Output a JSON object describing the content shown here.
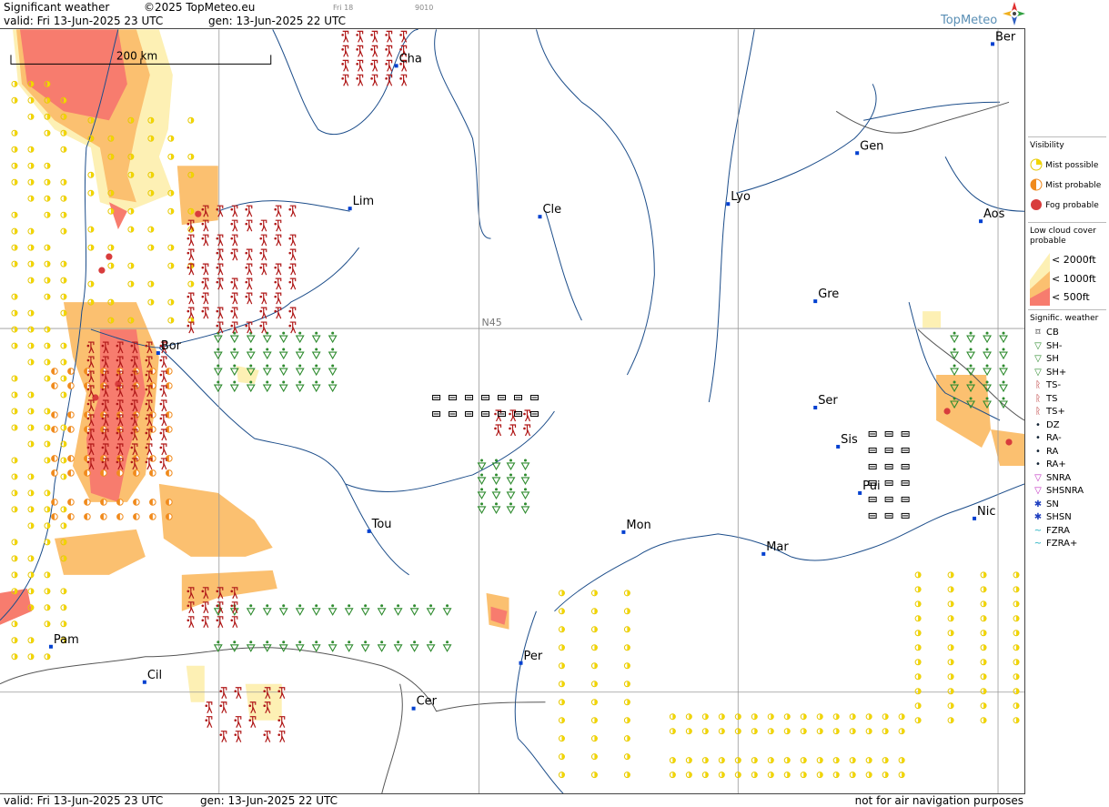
{
  "header": {
    "title": "Significant weather",
    "copyright": "©2025 TopMeteo.eu",
    "small_date": "Fri 18",
    "small_code": "9010",
    "valid": "valid:  Fri  13-Jun-2025  23 UTC",
    "gen": "gen: 13-Jun-2025 22 UTC",
    "logo": "TopMeteo"
  },
  "footer": {
    "valid": "valid:  Fri  13-Jun-2025  23 UTC",
    "gen": "gen: 13-Jun-2025 22 UTC",
    "disclaimer": "not for air navigation purposes"
  },
  "map": {
    "scale_label": "200 km",
    "lat_label": "N45",
    "cities": [
      {
        "name": "Cha"
      },
      {
        "name": "Lim"
      },
      {
        "name": "Cle"
      },
      {
        "name": "Lyo"
      },
      {
        "name": "Gen"
      },
      {
        "name": "Ber"
      },
      {
        "name": "Aos"
      },
      {
        "name": "Gre"
      },
      {
        "name": "Bor"
      },
      {
        "name": "Ser"
      },
      {
        "name": "Sis"
      },
      {
        "name": "Pui"
      },
      {
        "name": "Nic"
      },
      {
        "name": "Tou"
      },
      {
        "name": "Mon"
      },
      {
        "name": "Mar"
      },
      {
        "name": "Pam"
      },
      {
        "name": "Cil"
      },
      {
        "name": "Per"
      },
      {
        "name": "Cer"
      }
    ]
  },
  "legend": {
    "visibility_title": "Visibility",
    "visibility": [
      {
        "label": "Mist possible",
        "color": "#f2d600"
      },
      {
        "label": "Mist probable",
        "color": "#f08a1c"
      },
      {
        "label": "Fog probable",
        "color": "#e04848"
      }
    ],
    "cloud_title_1": "Low cloud cover",
    "cloud_title_2": "probable",
    "cloud": [
      {
        "label": "< 2000ft",
        "color": "#fdf0b4"
      },
      {
        "label": "< 1000ft",
        "color": "#fbc070"
      },
      {
        "label": "<   500ft",
        "color": "#f77c6e"
      }
    ],
    "wx_title": "Signific. weather",
    "wx": [
      {
        "label": "CB",
        "icon": "cb-icon"
      },
      {
        "label": "SH-",
        "icon": "shower-light-icon"
      },
      {
        "label": "SH",
        "icon": "shower-icon"
      },
      {
        "label": "SH+",
        "icon": "shower-heavy-icon"
      },
      {
        "label": "TS-",
        "icon": "thunderstorm-light-icon"
      },
      {
        "label": "TS",
        "icon": "thunderstorm-icon"
      },
      {
        "label": "TS+",
        "icon": "thunderstorm-heavy-icon"
      },
      {
        "label": "DZ",
        "icon": "drizzle-icon"
      },
      {
        "label": "RA-",
        "icon": "rain-light-icon"
      },
      {
        "label": "RA",
        "icon": "rain-icon"
      },
      {
        "label": "RA+",
        "icon": "rain-heavy-icon"
      },
      {
        "label": "SNRA",
        "icon": "snow-rain-icon"
      },
      {
        "label": "SHSNRA",
        "icon": "snow-rain-shower-icon"
      },
      {
        "label": "SN",
        "icon": "snow-icon"
      },
      {
        "label": "SHSN",
        "icon": "snow-shower-icon"
      },
      {
        "label": "FZRA",
        "icon": "freezing-rain-icon"
      },
      {
        "label": "FZRA+",
        "icon": "freezing-rain-heavy-icon"
      }
    ]
  }
}
